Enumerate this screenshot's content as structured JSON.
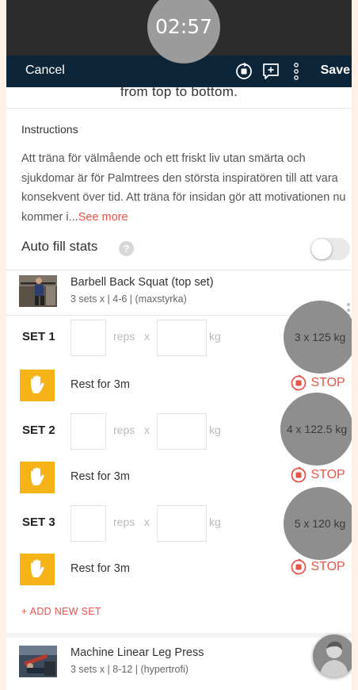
{
  "status_bar": {
    "timer": "02:57"
  },
  "toolbar": {
    "cancel_label": "Cancel",
    "save_label": "Save"
  },
  "description_tail": "from top to bottom.",
  "instructions": {
    "title": "Instructions",
    "body": "Att träna för välmående och ett friskt liv utan smärta och sjukdomar är för Palmtrees den största inspiratören till att vara konsekvent över tid. Att träna för insidan gör att motivationen nu kommer i...",
    "see_more": "See more"
  },
  "auto_fill": {
    "label": "Auto fill stats",
    "help": "?",
    "enabled": false
  },
  "exercises": [
    {
      "name": "Barbell Back Squat (top set)",
      "meta": "3 sets x | 4-6 | (maxstyrka)",
      "sets": [
        {
          "label": "SET 1",
          "reps_unit": "reps",
          "times": "x",
          "weight_unit": "kg",
          "previous": "3 x 125 kg"
        },
        {
          "label": "SET 2",
          "reps_unit": "reps",
          "times": "x",
          "weight_unit": "kg",
          "previous": "4 x 122.5 kg"
        },
        {
          "label": "SET 3",
          "reps_unit": "reps",
          "times": "x",
          "weight_unit": "kg",
          "previous": "5 x 120 kg"
        }
      ],
      "rest_label": "Rest for 3m",
      "stop_label": "STOP",
      "add_set_label": "+ ADD NEW SET"
    },
    {
      "name": "Machine Linear Leg Press",
      "meta": "3 sets x | 8-12 | (hypertrofi)"
    }
  ],
  "colors": {
    "accent": "#e8534a",
    "toolbar": "#0d2538",
    "rest_icon_bg": "#f5b317",
    "status_bar": "#2c2c2c"
  },
  "icons": [
    "stop-timer-icon",
    "add-comment-icon",
    "more-vertical-icon",
    "help-icon",
    "hand-icon",
    "stop-circle-icon"
  ]
}
